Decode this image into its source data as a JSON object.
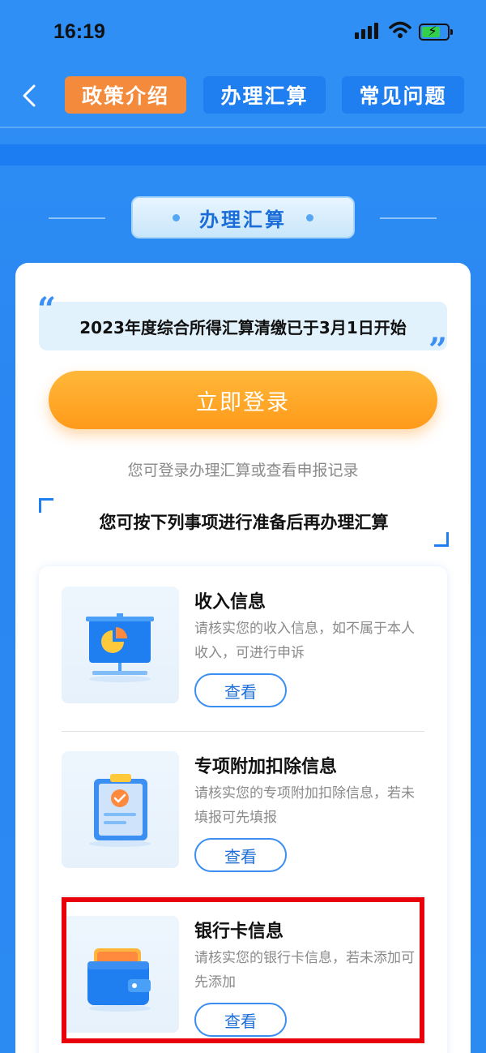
{
  "status_bar": {
    "time": "16:19"
  },
  "nav": {
    "tabs": [
      {
        "label": "政策介绍",
        "active": true
      },
      {
        "label": "办理汇算",
        "active": false
      },
      {
        "label": "常见问题",
        "active": false
      }
    ]
  },
  "section": {
    "title": "办理汇算"
  },
  "card": {
    "notice": "2023年度综合所得汇算清缴已于3月1日开始",
    "login_button": "立即登录",
    "login_hint": "您可登录办理汇算或查看申报记录",
    "prep_title": "您可按下列事项进行准备后再办理汇算",
    "items": [
      {
        "title": "收入信息",
        "desc": "请核实您的收入信息，如不属于本人收入，可进行申诉",
        "button": "查看",
        "icon": "presentation-chart-icon"
      },
      {
        "title": "专项附加扣除信息",
        "desc": "请核实您的专项附加扣除信息，若未填报可先填报",
        "button": "查看",
        "icon": "clipboard-check-icon"
      },
      {
        "title": "银行卡信息",
        "desc": "请核实您的银行卡信息，若未添加可先添加",
        "button": "查看",
        "icon": "wallet-icon"
      }
    ]
  },
  "colors": {
    "accent": "#2f8ff5",
    "active_tab": "#f48a3c",
    "login_button": "#ffa726",
    "highlight": "#e8000b"
  }
}
